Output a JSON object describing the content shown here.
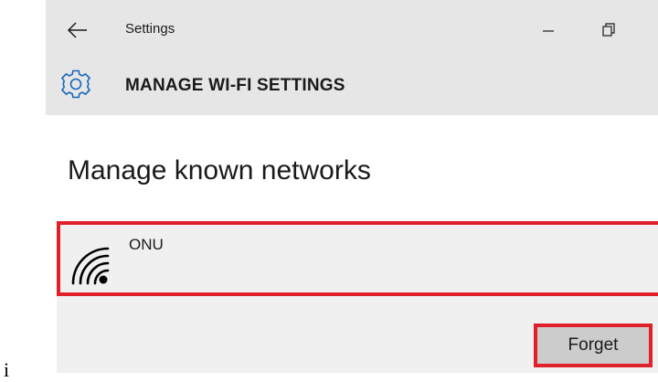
{
  "window": {
    "title": "Settings",
    "minimize_icon": "minimize-icon",
    "restore_icon": "restore-icon",
    "back_icon": "back-arrow-icon"
  },
  "header": {
    "icon": "gear-icon",
    "title": "MANAGE WI-FI SETTINGS"
  },
  "main": {
    "heading": "Manage known networks",
    "networks": [
      {
        "name": "ONU",
        "icon": "wifi-signal-icon"
      }
    ],
    "forget_label": "Forget"
  },
  "stray_text": "i",
  "colors": {
    "highlight": "#e0202a",
    "titlebar_bg": "#e6e6e6",
    "item_bg": "#f0f0f0",
    "button_bg": "#cccccc"
  }
}
